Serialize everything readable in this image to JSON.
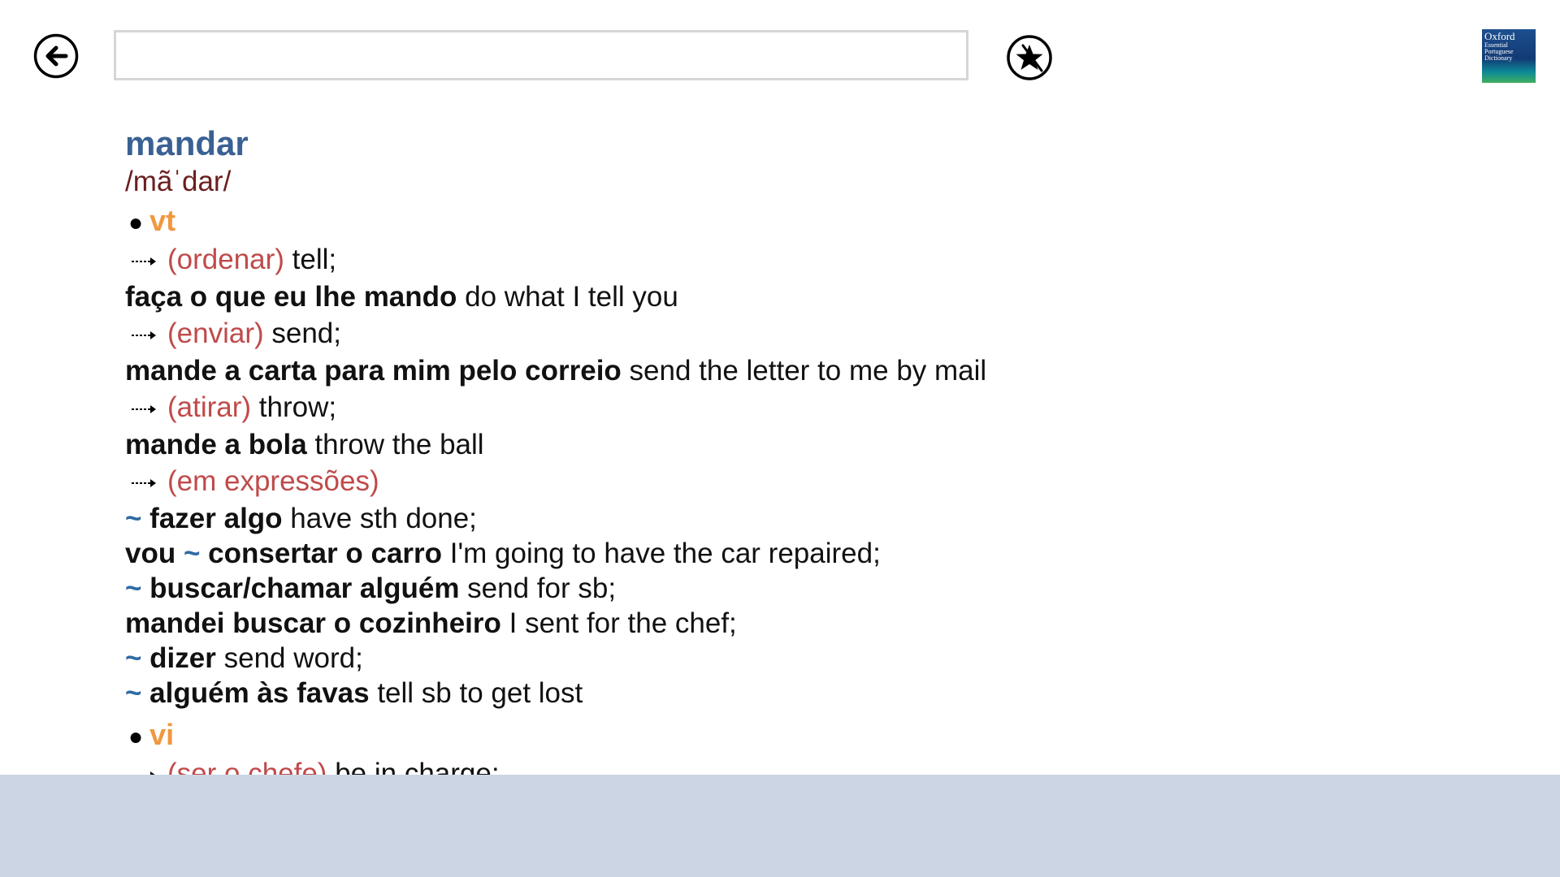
{
  "toolbar": {
    "back_icon": "back-arrow-circle-icon",
    "search_value": "",
    "favorite_icon": "star-circle-icon",
    "logo_line1": "Oxford",
    "logo_line2": "Essential Portuguese Dictionary"
  },
  "entry": {
    "headword": "mandar",
    "pronunciation": "/mãˈdar/",
    "pos_vt": "vt",
    "senses_vt": [
      {
        "gloss": "(ordenar)",
        "translation": " tell;",
        "example": "faça o que eu lhe mando",
        "example_tr": " do what I tell you"
      },
      {
        "gloss": "(enviar)",
        "translation": " send;",
        "example": "mande a carta para mim pelo correio",
        "example_tr": " send the letter to me by mail"
      },
      {
        "gloss": "(atirar)",
        "translation": " throw;",
        "example": "mande a bola",
        "example_tr": " throw the ball"
      }
    ],
    "expressions_gloss": "(em expressões)",
    "expressions": [
      {
        "pre": "",
        "tilde": "~",
        "phrase": " fazer algo",
        "tr": " have sth done;"
      },
      {
        "pre": "vou ",
        "tilde": "~",
        "phrase": " consertar o carro",
        "tr": " I'm going to have the car repaired;"
      },
      {
        "pre": "",
        "tilde": "~",
        "phrase": " buscar/chamar alguém",
        "tr": " send for sb;"
      },
      {
        "pre": "mandei buscar o cozinheiro",
        "tilde": "",
        "phrase": "",
        "tr": " I sent for the chef;"
      },
      {
        "pre": "",
        "tilde": "~",
        "phrase": " dizer",
        "tr": " send word;"
      },
      {
        "pre": "",
        "tilde": "~",
        "phrase": " alguém às favas",
        "tr": " tell sb to get lost"
      }
    ],
    "pos_vi": "vi",
    "sense_vi": {
      "gloss": "(ser o chefe)",
      "translation": " be in charge;"
    }
  }
}
